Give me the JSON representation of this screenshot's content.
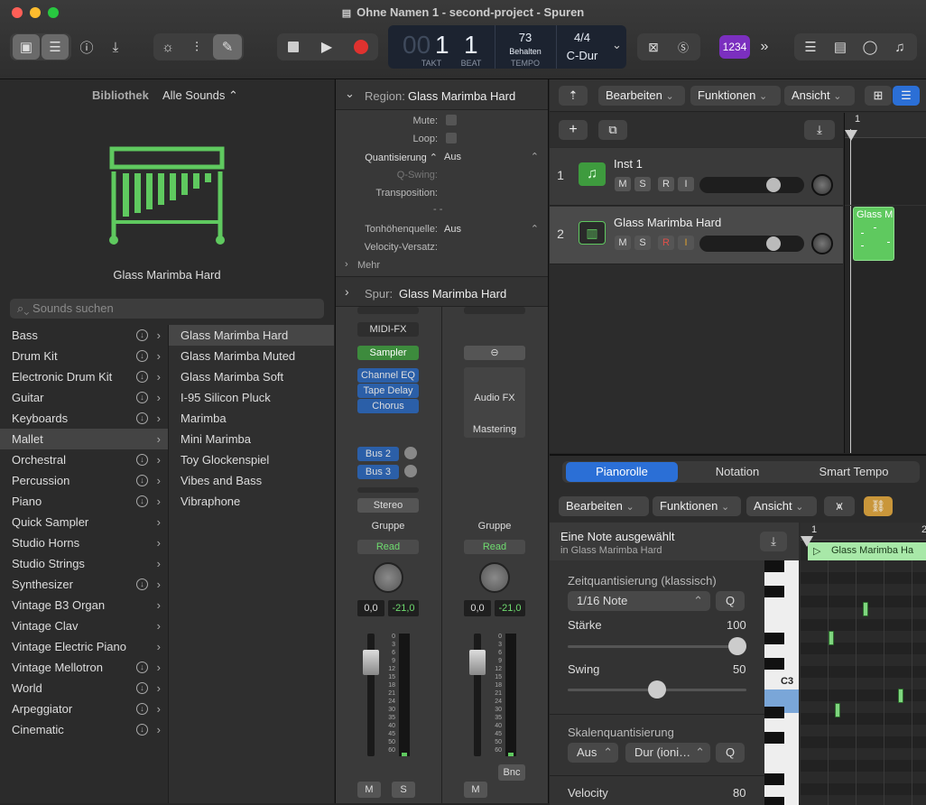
{
  "window": {
    "title": "Ohne Namen 1 - second-project - Spuren"
  },
  "lcd": {
    "bar": "1",
    "bar_label": "TAKT",
    "beat": "1",
    "beat_label": "BEAT",
    "tempo": "73",
    "tempo_mode": "Behalten",
    "tempo_label": "TEMPO",
    "signature": "4/4",
    "key": "C-Dur",
    "bar_dim": "00"
  },
  "toolbar": {
    "count_in": "1234"
  },
  "library": {
    "title": "Bibliothek",
    "filter": "Alle Sounds",
    "instrument_name": "Glass Marimba Hard",
    "search_placeholder": "Sounds suchen",
    "categories": [
      {
        "label": "Bass",
        "download": true
      },
      {
        "label": "Drum Kit",
        "download": true
      },
      {
        "label": "Electronic Drum Kit",
        "download": true
      },
      {
        "label": "Guitar",
        "download": true
      },
      {
        "label": "Keyboards",
        "download": true
      },
      {
        "label": "Mallet",
        "download": false,
        "selected": true
      },
      {
        "label": "Orchestral",
        "download": true
      },
      {
        "label": "Percussion",
        "download": true
      },
      {
        "label": "Piano",
        "download": true
      },
      {
        "label": "Quick Sampler",
        "download": false
      },
      {
        "label": "Studio Horns",
        "download": false
      },
      {
        "label": "Studio Strings",
        "download": false
      },
      {
        "label": "Synthesizer",
        "download": true
      },
      {
        "label": "Vintage B3 Organ",
        "download": false
      },
      {
        "label": "Vintage Clav",
        "download": false
      },
      {
        "label": "Vintage Electric Piano",
        "download": false
      },
      {
        "label": "Vintage Mellotron",
        "download": true
      },
      {
        "label": "World",
        "download": true
      },
      {
        "label": "Arpeggiator",
        "download": true
      },
      {
        "label": "Cinematic",
        "download": true
      }
    ],
    "sounds": [
      "Glass Marimba Hard",
      "Glass Marimba Muted",
      "Glass Marimba Soft",
      "I-95 Silicon Pluck",
      "Marimba",
      "Mini Marimba",
      "Toy Glockenspiel",
      "Vibes and Bass",
      "Vibraphone"
    ]
  },
  "region": {
    "header_label": "Region:",
    "header_name": "Glass Marimba Hard",
    "mute_label": "Mute:",
    "loop_label": "Loop:",
    "quantize_label": "Quantisierung",
    "quantize_value": "Aus",
    "qswing_label": "Q-Swing:",
    "transpose_label": "Transposition:",
    "transpose_value": "- -",
    "pitch_source_label": "Tonhöhenquelle:",
    "pitch_source_value": "Aus",
    "velocity_label": "Velocity-Versatz:",
    "more_label": "Mehr"
  },
  "track_inspector": {
    "label": "Spur:",
    "name": "Glass Marimba Hard"
  },
  "strip1": {
    "midi_fx": "MIDI-FX",
    "instrument": "Sampler",
    "plugins": [
      "Channel EQ",
      "Tape Delay",
      "Chorus"
    ],
    "sends": [
      "Bus 2",
      "Bus 3"
    ],
    "output": "Stereo",
    "group": "Gruppe",
    "automation": "Read",
    "pan_value": "0,0",
    "level": "-21,0",
    "mute": "M",
    "solo": "S"
  },
  "strip2": {
    "audio_fx": "Audio FX",
    "mastering": "Mastering",
    "group": "Gruppe",
    "automation": "Read",
    "pan_value": "0,0",
    "level": "-21,0",
    "bounce": "Bnc",
    "mute": "M"
  },
  "meter_scale": [
    "0",
    "3",
    "6",
    "9",
    "12",
    "15",
    "18",
    "21",
    "24",
    "30",
    "35",
    "40",
    "45",
    "50",
    "60"
  ],
  "tracks_toolbar": {
    "edit": "Bearbeiten",
    "functions": "Funktionen",
    "view": "Ansicht"
  },
  "tracks": [
    {
      "number": "1",
      "name": "Inst 1",
      "buttons": [
        "M",
        "S",
        "R",
        "I"
      ]
    },
    {
      "number": "2",
      "name": "Glass Marimba Hard",
      "buttons": [
        "M",
        "S",
        "R",
        "I"
      ]
    }
  ],
  "timeline": {
    "bar": "1",
    "region_name": "Glass M"
  },
  "piano_roll": {
    "tabs": [
      "Pianorolle",
      "Notation",
      "Smart Tempo"
    ],
    "edit": "Bearbeiten",
    "functions": "Funktionen",
    "view": "Ansicht",
    "note_status": "Eine Note ausgewählt",
    "note_region": "in Glass Marimba Hard",
    "time_quant_label": "Zeitquantisierung (klassisch)",
    "time_quant_value": "1/16 Note",
    "q_button": "Q",
    "strength_label": "Stärke",
    "strength_value": "100",
    "swing_label": "Swing",
    "swing_value": "50",
    "scale_quant_label": "Skalenquantisierung",
    "scale_root": "Aus",
    "scale_mode": "Dur (ioni…",
    "velocity_label": "Velocity",
    "velocity_value": "80",
    "key_label": "C3",
    "bar_1": "1",
    "bar_2": "2",
    "region_name": "Glass Marimba Ha"
  },
  "colors": {
    "accent_green": "#5fc95f",
    "accent_blue": "#2b6fd6",
    "count_in_purple": "#7b2fbf"
  }
}
